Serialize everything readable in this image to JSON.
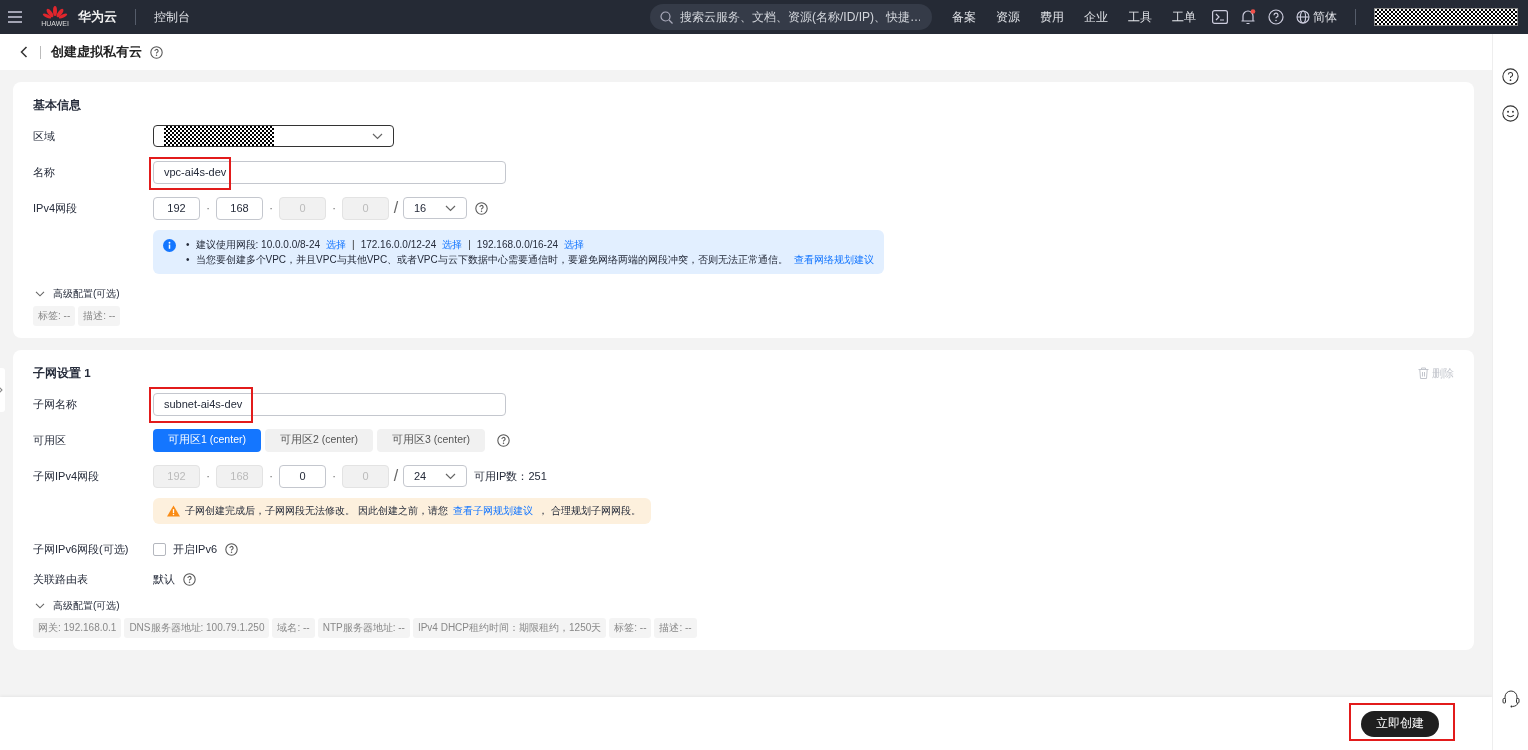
{
  "topbar": {
    "logo_text": "HUAWEI",
    "brand": "华为云",
    "console": "控制台",
    "search": {
      "placeholder": "搜索云服务、文档、资源(名称/ID/IP)、快捷…"
    },
    "nav": [
      "备案",
      "资源",
      "费用",
      "企业",
      "工具",
      "工单"
    ],
    "notification_dot": true,
    "language": "简体"
  },
  "page": {
    "title": "创建虚拟私有云"
  },
  "basic": {
    "title": "基本信息",
    "region_label": "区域",
    "name_label": "名称",
    "name": {
      "value": "vpc-ai4s-dev",
      "highlighted": true
    },
    "ipv4_label": "IPv4网段",
    "octets": [
      {
        "value": "192",
        "disabled": false
      },
      {
        "value": "168",
        "disabled": false
      },
      {
        "value": "0",
        "disabled": true
      },
      {
        "value": "0",
        "disabled": true
      }
    ],
    "octet_separator": "·",
    "slash": "/",
    "mask": "16",
    "bullet": "•",
    "pipe": "|",
    "tips": [
      {
        "segments": [
          {
            "text": "建议使用网段: 10.0.0.0/8-24",
            "link": "选择"
          },
          {
            "text": "172.16.0.0/12-24",
            "link": "选择"
          },
          {
            "text": "192.168.0.0/16-24",
            "link": "选择"
          }
        ]
      },
      {
        "segments": [
          {
            "text": "当您要创建多个VPC，并且VPC与其他VPC、或者VPC与云下数据中心需要通信时，要避免网络两端的网段冲突，否则无法正常通信。",
            "link": "查看网络规划建议"
          }
        ]
      }
    ],
    "advanced": {
      "label": "高级配置(可选)",
      "tags": [
        "标签: --",
        "描述: --"
      ]
    }
  },
  "subnet": {
    "title": "子网设置 1",
    "delete": {
      "label": "删除",
      "disabled": true
    },
    "name_label": "子网名称",
    "name": {
      "value": "subnet-ai4s-dev",
      "highlighted": true
    },
    "az_label": "可用区",
    "zones": [
      {
        "label": "可用区1 (center)",
        "selected": true
      },
      {
        "label": "可用区2 (center)",
        "selected": false
      },
      {
        "label": "可用区3 (center)",
        "selected": false
      }
    ],
    "ipv4_label": "子网IPv4网段",
    "octets": [
      {
        "value": "192",
        "disabled": true
      },
      {
        "value": "168",
        "disabled": true
      },
      {
        "value": "0",
        "disabled": false
      },
      {
        "value": "0",
        "disabled": true
      }
    ],
    "octet_separator": "·",
    "slash": "/",
    "mask": "24",
    "available_ips": "可用IP数：251",
    "warning": {
      "before": "子网创建完成后，子网网段无法修改。 因此创建之前，请您",
      "link": "查看子网规划建议",
      "after": "， 合理规划子网网段。"
    },
    "ipv6_label": "子网IPv6网段(可选)",
    "ipv6": {
      "label": "开启IPv6",
      "checked": false
    },
    "route_label": "关联路由表",
    "route_value": "默认",
    "advanced": {
      "label": "高级配置(可选)",
      "tags": [
        "网关: 192.168.0.1",
        "DNS服务器地址: 100.79.1.250",
        "域名: --",
        "NTP服务器地址: --",
        "IPv4 DHCP租约时间：期限租约，1250天",
        "标签: --",
        "描述: --"
      ]
    }
  },
  "footer": {
    "submit": {
      "label": "立即创建",
      "highlighted": true
    }
  }
}
